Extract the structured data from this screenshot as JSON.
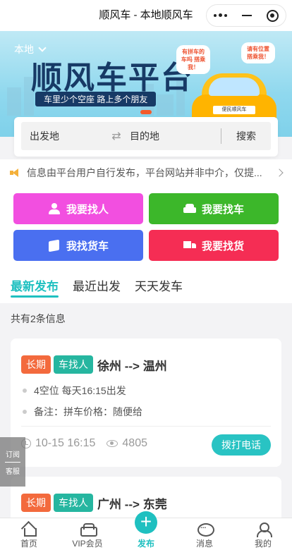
{
  "navbar": {
    "title": "顺风车 - 本地顺风车"
  },
  "banner": {
    "region": "本地",
    "headline": "顺风车平台",
    "slogan": "车里少个空座  路上多个朋友",
    "bubble_left": "有拼车的车吗 搭乘我！",
    "bubble_right": "请有位置 搭乘我！",
    "car_tag": "便民顺风车"
  },
  "search": {
    "from_placeholder": "出发地",
    "to_placeholder": "目的地",
    "button": "搜索"
  },
  "notice": {
    "text": "信息由平台用户自行发布，平台网站并非中介，仅提..."
  },
  "actions": [
    {
      "label": "我要找人",
      "color": "#f24fe0",
      "icon": "person-icon"
    },
    {
      "label": "我要找车",
      "color": "#3cb72a",
      "icon": "car-icon"
    },
    {
      "label": "我找货车",
      "color": "#4a6ff0",
      "icon": "box-icon"
    },
    {
      "label": "我要找货",
      "color": "#f52d54",
      "icon": "truck-icon"
    }
  ],
  "tabs": [
    {
      "label": "最新发布",
      "active": true
    },
    {
      "label": "最近出发",
      "active": false
    },
    {
      "label": "天天发车",
      "active": false
    }
  ],
  "count_text": "共有2条信息",
  "listings": [
    {
      "badge_duration": "长期",
      "badge_type": "车找人",
      "route": "徐州 --> 温州",
      "seats_schedule": "4空位   每天16:15出发",
      "remark": "备注：拼车价格：随便给",
      "datetime": "10-15 16:15",
      "views": "4805",
      "call_label": "拨打电话"
    },
    {
      "badge_duration": "长期",
      "badge_type": "车找人",
      "route": "广州 --> 东莞"
    }
  ],
  "float_side": {
    "subscribe": "订阅",
    "service": "客服"
  },
  "tabbar": [
    {
      "label": "首页",
      "icon": "home-icon"
    },
    {
      "label": "VIP会员",
      "icon": "vip-car-icon"
    },
    {
      "label": "发布",
      "icon": "plus-icon",
      "active": true
    },
    {
      "label": "消息",
      "icon": "message-icon"
    },
    {
      "label": "我的",
      "icon": "user-icon"
    }
  ],
  "colors": {
    "accent": "#1fc0c0",
    "badge_long": "#f36a3d",
    "badge_type": "#26b6a0"
  }
}
